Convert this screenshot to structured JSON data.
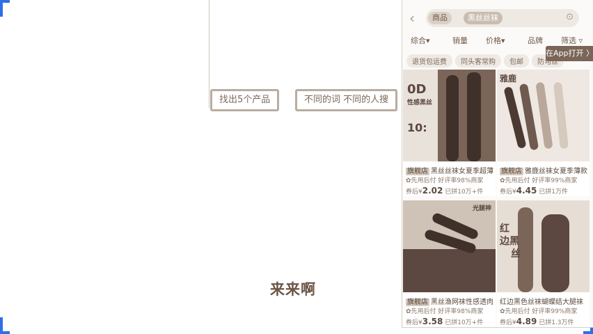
{
  "page": {
    "tag_left": "找出5个产品",
    "tag_right": "不同的词 不同的人搜",
    "caption": "来来啊"
  },
  "search": {
    "back_icon": "‹",
    "chip1": "商品",
    "chip2": "黑丝丝袜",
    "button": "⊙"
  },
  "sort_bar": [
    "综合▾",
    "销量",
    "价格▾",
    "品牌",
    "筛选 ▿"
  ],
  "app_button": "在App打开 〉",
  "filter_chips": [
    "退货包运费",
    "同头客常购",
    "包邮",
    "防勾丝"
  ],
  "products": [
    {
      "image_text_1": "0D",
      "image_text_2": "性感黑丝",
      "image_text_3": "10:",
      "badge": "旗舰店",
      "title": "黑丝丝袜女夏季超薄",
      "service": "✿先用后付  好评率98%商家",
      "price_prefix": "券后¥",
      "price": "2.02",
      "sold": "已拼10万+件"
    },
    {
      "image_text_1": "雅鹿",
      "image_text_2": "",
      "image_text_3": "",
      "badge": "旗舰店",
      "title": "雅鹿丝袜女夏季薄款",
      "service": "✿先用后付  好评率99%商家",
      "price_prefix": "券后¥",
      "price": "4.45",
      "sold": "已拼1万件"
    },
    {
      "image_text_1": "光腿神",
      "image_text_2": "",
      "image_text_3": "",
      "badge": "旗舰店",
      "title": "黑丝渔网袜性感透肉",
      "service": "✿先用后付  好评率98%商家",
      "price_prefix": "券后¥",
      "price": "3.58",
      "sold": "已拼10万+件"
    },
    {
      "image_text_1": "红",
      "image_text_2": "边黑",
      "image_text_3": "丝",
      "badge": "",
      "title": "红边黑色丝袜蝴蝶结大腿袜",
      "service": "✿先用后付  好评率99%商家",
      "price_prefix": "券后¥",
      "price": "4.89",
      "sold": "已拼1.3万件"
    }
  ],
  "colors": {
    "corner_marker": "#2f6fe6",
    "accent": "#7a6558"
  }
}
